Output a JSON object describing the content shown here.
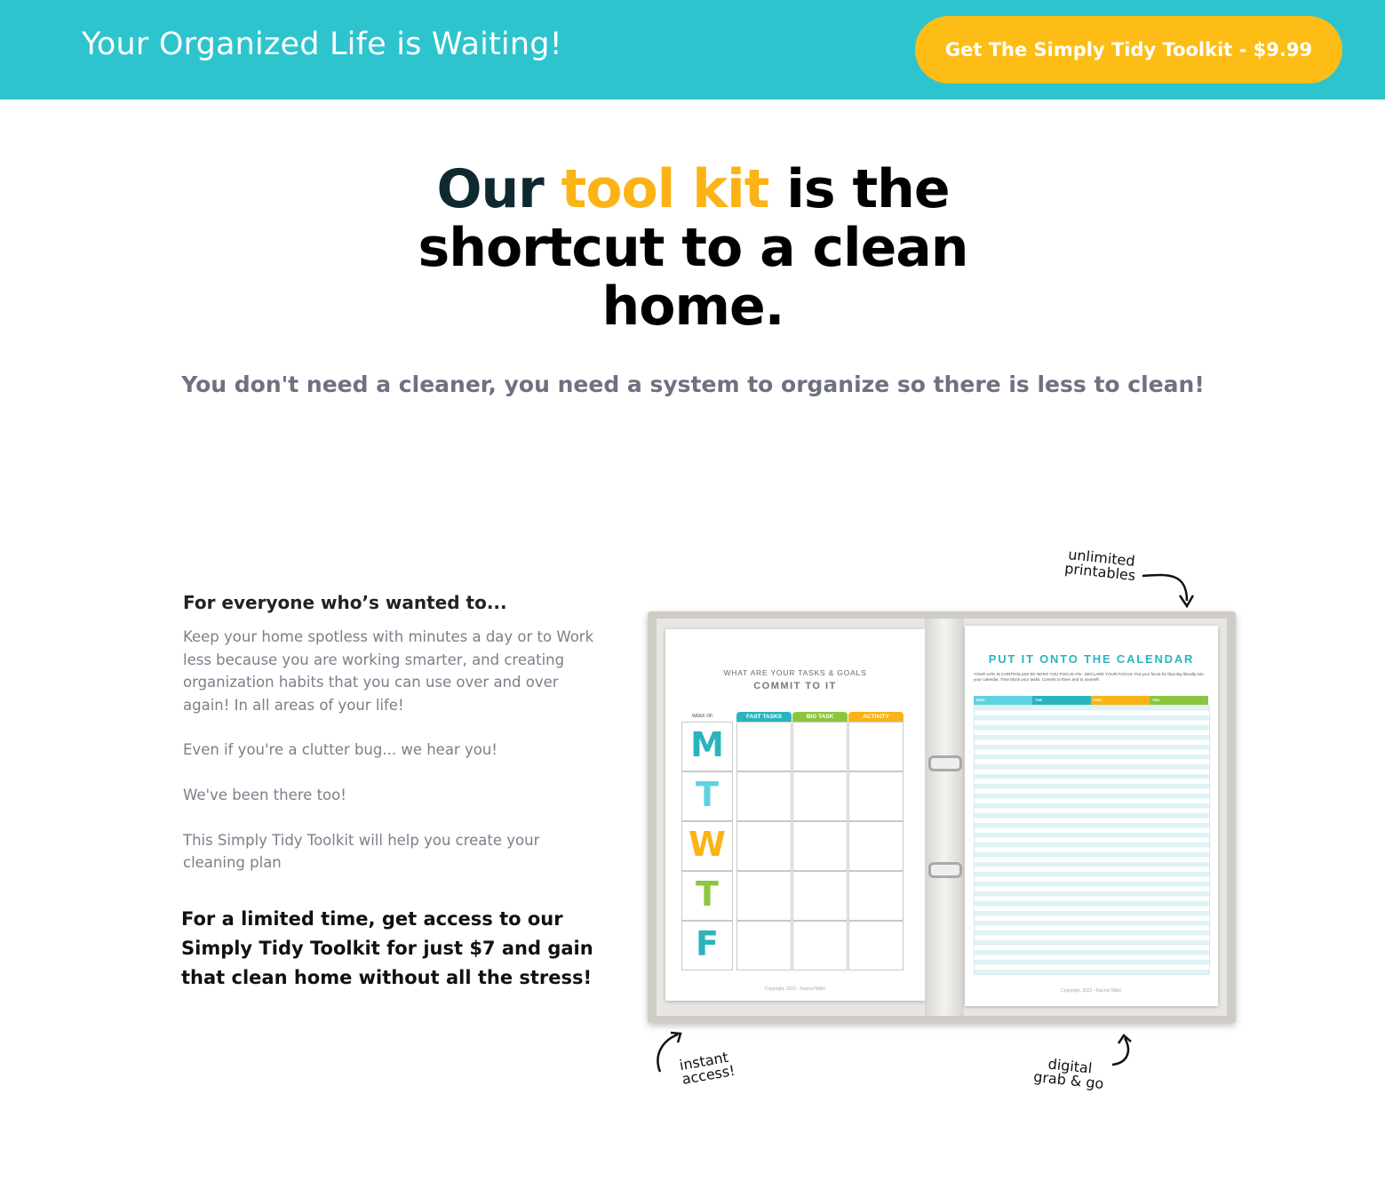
{
  "topbar": {
    "title": "Your Organized Life is Waiting!",
    "cta_label": "Get The Simply Tidy Toolkit - $9.99",
    "bg_color": "#2ec4ce",
    "cta_color": "#fdbd16"
  },
  "hero": {
    "headline_part1": "Our ",
    "headline_accent": "tool kit",
    "headline_part2": " is the shortcut to a clean home.",
    "accent_color": "#fbb315",
    "subheadline": "You don't need a cleaner, you need a system to organize so there is less to clean!"
  },
  "content": {
    "intro_heading": "For everyone who’s wanted to...",
    "paragraph1": "Keep your home spotless with minutes a day or to Work less because you are working smarter, and creating organization habits that you can use over and over again!  In all areas of your life!",
    "paragraph2": "Even if you're a clutter bug... we hear you!",
    "paragraph3": "We've been there too!",
    "paragraph4": "This Simply Tidy Toolkit will help you create your cleaning plan",
    "offer": "For a limited time, get access to our Simply Tidy Toolkit for just $7 and gain that clean home without all the stress!"
  },
  "mockup": {
    "left_page": {
      "subtitle": "WHAT ARE YOUR TASKS & GOALS",
      "title": "COMMIT TO IT",
      "week_label": "WEEK OF:",
      "columns": [
        "FAST TASKS",
        "BIG TASK",
        "ACTIVITY"
      ],
      "column_colors": [
        "#2ab4bf",
        "#8cc63f",
        "#fbb315"
      ],
      "days": [
        "M",
        "T",
        "W",
        "T",
        "F"
      ],
      "day_colors": [
        "#2ab4bf",
        "#5fd3e0",
        "#fbb315",
        "#8cc63f",
        "#2ab4bf"
      ],
      "copyright": "Copyright, 2022 - Rachel Miller"
    },
    "right_page": {
      "title": "PUT IT ONTO THE CALENDAR",
      "text": "YOUR LIFE IS CONTROLLED BY WHAT YOU FOCUS ON - DECLARE YOUR FOCUS. Put your focus for that day literally into your calendar. Time block your tasks. Commit to them and to yourself.",
      "columns": [
        "MON",
        "TUE",
        "WED",
        "THU"
      ],
      "column_colors": [
        "#5fd3e0",
        "#2ab4bf",
        "#fbb315",
        "#8cc63f"
      ],
      "copyright": "Copyright, 2022 - Rachel Miller"
    }
  },
  "annotations": {
    "unlimited_line1": "unlimited",
    "unlimited_line2": "printables",
    "instant_line1": "instant",
    "instant_line2": "access!",
    "digital_line1": "digital",
    "digital_line2": "grab & go"
  }
}
